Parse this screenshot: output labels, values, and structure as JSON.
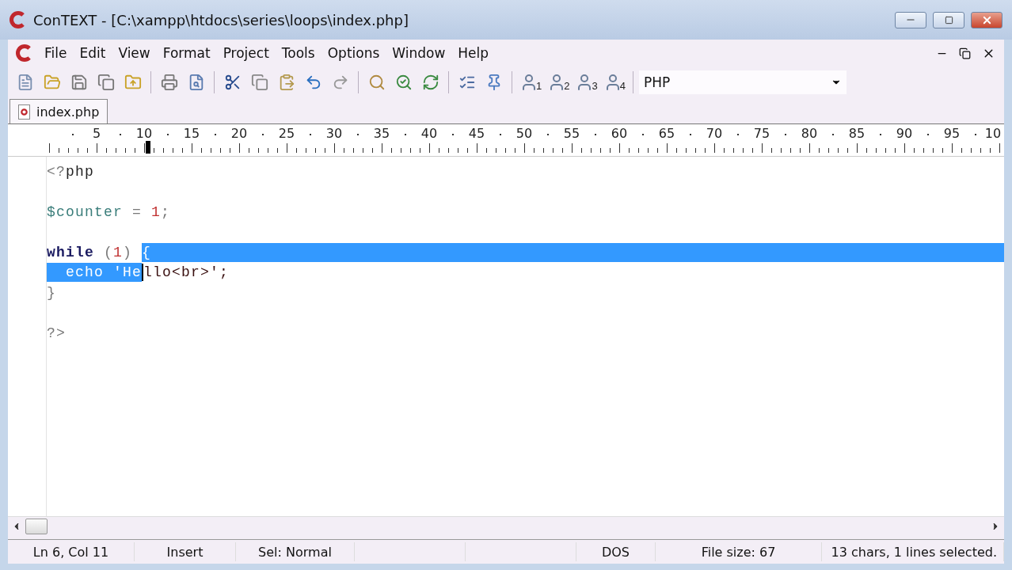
{
  "window": {
    "title": "ConTEXT - [C:\\xampp\\htdocs\\series\\loops\\index.php]"
  },
  "menu": [
    "File",
    "Edit",
    "View",
    "Format",
    "Project",
    "Tools",
    "Options",
    "Window",
    "Help"
  ],
  "user_buttons": [
    "1",
    "2",
    "3",
    "4"
  ],
  "language": {
    "value": "PHP"
  },
  "tabs": [
    {
      "label": "index.php",
      "selected": true
    }
  ],
  "ruler": {
    "labels": [
      {
        "text": "5",
        "marked": false
      },
      {
        "text": "10",
        "marked": true
      },
      {
        "text": "15",
        "marked": false
      },
      {
        "text": "20",
        "marked": false
      },
      {
        "text": "25",
        "marked": false
      },
      {
        "text": "30",
        "marked": false
      },
      {
        "text": "35",
        "marked": false
      },
      {
        "text": "40",
        "marked": false
      },
      {
        "text": "45",
        "marked": false
      },
      {
        "text": "50",
        "marked": false
      },
      {
        "text": "55",
        "marked": false
      },
      {
        "text": "60",
        "marked": false
      },
      {
        "text": "65",
        "marked": false
      },
      {
        "text": "70",
        "marked": false
      },
      {
        "text": "75",
        "marked": false
      },
      {
        "text": "80",
        "marked": false
      },
      {
        "text": "85",
        "marked": false
      },
      {
        "text": "90",
        "marked": false
      },
      {
        "text": "95",
        "marked": false
      },
      {
        "text": "10",
        "marked": false
      }
    ]
  },
  "editor": {
    "lines": [
      {
        "kind": "code",
        "selected_to_end": false,
        "tokens": [
          {
            "text": "<?",
            "kind": "delimiter",
            "selected": false,
            "caret": false
          },
          {
            "text": "php",
            "kind": "plain",
            "selected": false,
            "caret": false
          }
        ]
      },
      {
        "kind": "blank"
      },
      {
        "kind": "code",
        "selected_to_end": false,
        "tokens": [
          {
            "text": "$counter",
            "kind": "variable",
            "selected": false,
            "caret": false
          },
          {
            "text": " = ",
            "kind": "operator",
            "selected": false,
            "caret": false
          },
          {
            "text": "1",
            "kind": "number",
            "selected": false,
            "caret": false
          },
          {
            "text": ";",
            "kind": "operator",
            "selected": false,
            "caret": false
          }
        ]
      },
      {
        "kind": "blank"
      },
      {
        "kind": "code",
        "selected_to_end": true,
        "tokens": [
          {
            "text": "while",
            "kind": "keyword",
            "selected": false,
            "caret": false
          },
          {
            "text": " (",
            "kind": "operator",
            "selected": false,
            "caret": false
          },
          {
            "text": "1",
            "kind": "number",
            "selected": false,
            "caret": false
          },
          {
            "text": ") ",
            "kind": "operator",
            "selected": false,
            "caret": false
          },
          {
            "text": "{",
            "kind": "operator",
            "selected": true,
            "caret": false
          }
        ]
      },
      {
        "kind": "code",
        "selected_to_end": false,
        "tokens": [
          {
            "text": "  echo 'He",
            "kind": "string",
            "selected": true,
            "caret": true
          },
          {
            "text": "llo<br>';",
            "kind": "string",
            "selected": false,
            "caret": false
          }
        ]
      },
      {
        "kind": "code",
        "selected_to_end": false,
        "tokens": [
          {
            "text": "}",
            "kind": "operator",
            "selected": false,
            "caret": false
          }
        ]
      },
      {
        "kind": "blank"
      },
      {
        "kind": "code",
        "selected_to_end": false,
        "tokens": [
          {
            "text": "?>",
            "kind": "delimiter",
            "selected": false,
            "caret": false
          }
        ]
      }
    ]
  },
  "status_bar": [
    {
      "kind": "text",
      "text": "Ln 6, Col 11"
    },
    {
      "kind": "text",
      "text": "Insert"
    },
    {
      "kind": "text",
      "text": "Sel: Normal"
    },
    {
      "kind": "empty"
    },
    {
      "kind": "empty"
    },
    {
      "kind": "text",
      "text": "DOS"
    },
    {
      "kind": "text",
      "text": "File size: 67"
    },
    {
      "kind": "text",
      "text": "13 chars, 1 lines selected."
    }
  ]
}
